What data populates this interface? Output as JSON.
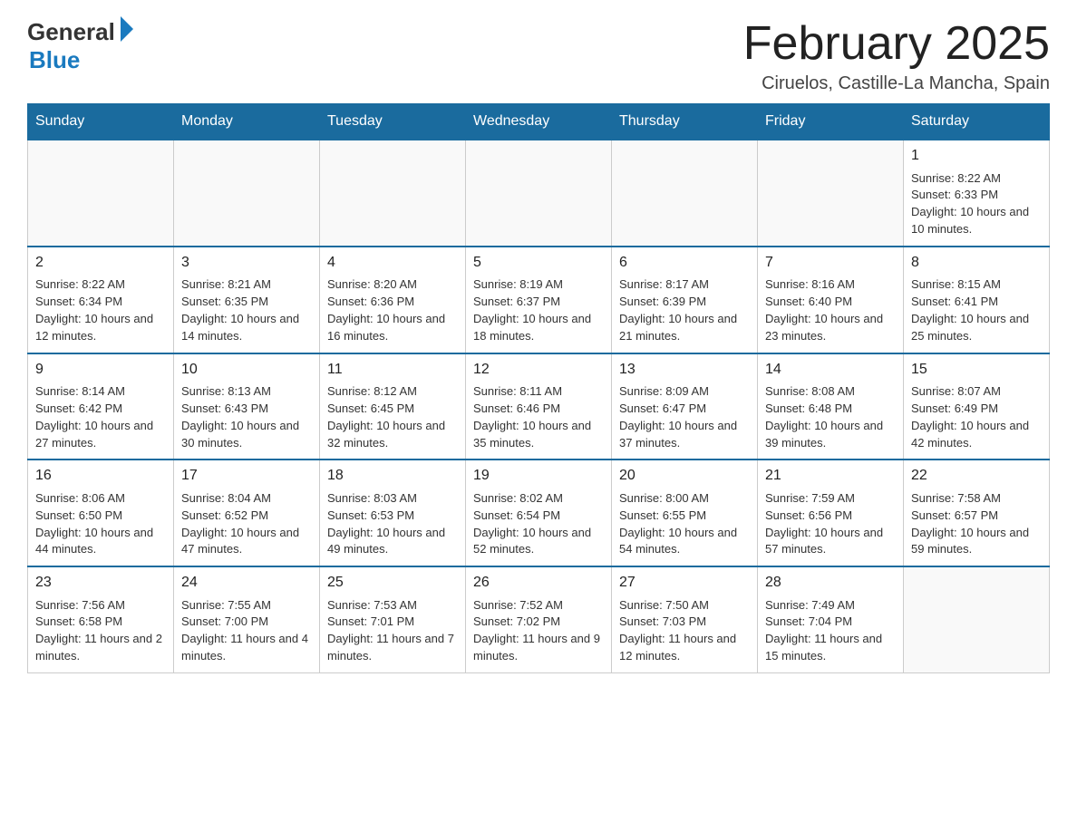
{
  "header": {
    "logo_general": "General",
    "logo_blue": "Blue",
    "month_title": "February 2025",
    "location": "Ciruelos, Castille-La Mancha, Spain"
  },
  "weekdays": [
    "Sunday",
    "Monday",
    "Tuesday",
    "Wednesday",
    "Thursday",
    "Friday",
    "Saturday"
  ],
  "weeks": [
    [
      {
        "day": "",
        "info": ""
      },
      {
        "day": "",
        "info": ""
      },
      {
        "day": "",
        "info": ""
      },
      {
        "day": "",
        "info": ""
      },
      {
        "day": "",
        "info": ""
      },
      {
        "day": "",
        "info": ""
      },
      {
        "day": "1",
        "info": "Sunrise: 8:22 AM\nSunset: 6:33 PM\nDaylight: 10 hours and 10 minutes."
      }
    ],
    [
      {
        "day": "2",
        "info": "Sunrise: 8:22 AM\nSunset: 6:34 PM\nDaylight: 10 hours and 12 minutes."
      },
      {
        "day": "3",
        "info": "Sunrise: 8:21 AM\nSunset: 6:35 PM\nDaylight: 10 hours and 14 minutes."
      },
      {
        "day": "4",
        "info": "Sunrise: 8:20 AM\nSunset: 6:36 PM\nDaylight: 10 hours and 16 minutes."
      },
      {
        "day": "5",
        "info": "Sunrise: 8:19 AM\nSunset: 6:37 PM\nDaylight: 10 hours and 18 minutes."
      },
      {
        "day": "6",
        "info": "Sunrise: 8:17 AM\nSunset: 6:39 PM\nDaylight: 10 hours and 21 minutes."
      },
      {
        "day": "7",
        "info": "Sunrise: 8:16 AM\nSunset: 6:40 PM\nDaylight: 10 hours and 23 minutes."
      },
      {
        "day": "8",
        "info": "Sunrise: 8:15 AM\nSunset: 6:41 PM\nDaylight: 10 hours and 25 minutes."
      }
    ],
    [
      {
        "day": "9",
        "info": "Sunrise: 8:14 AM\nSunset: 6:42 PM\nDaylight: 10 hours and 27 minutes."
      },
      {
        "day": "10",
        "info": "Sunrise: 8:13 AM\nSunset: 6:43 PM\nDaylight: 10 hours and 30 minutes."
      },
      {
        "day": "11",
        "info": "Sunrise: 8:12 AM\nSunset: 6:45 PM\nDaylight: 10 hours and 32 minutes."
      },
      {
        "day": "12",
        "info": "Sunrise: 8:11 AM\nSunset: 6:46 PM\nDaylight: 10 hours and 35 minutes."
      },
      {
        "day": "13",
        "info": "Sunrise: 8:09 AM\nSunset: 6:47 PM\nDaylight: 10 hours and 37 minutes."
      },
      {
        "day": "14",
        "info": "Sunrise: 8:08 AM\nSunset: 6:48 PM\nDaylight: 10 hours and 39 minutes."
      },
      {
        "day": "15",
        "info": "Sunrise: 8:07 AM\nSunset: 6:49 PM\nDaylight: 10 hours and 42 minutes."
      }
    ],
    [
      {
        "day": "16",
        "info": "Sunrise: 8:06 AM\nSunset: 6:50 PM\nDaylight: 10 hours and 44 minutes."
      },
      {
        "day": "17",
        "info": "Sunrise: 8:04 AM\nSunset: 6:52 PM\nDaylight: 10 hours and 47 minutes."
      },
      {
        "day": "18",
        "info": "Sunrise: 8:03 AM\nSunset: 6:53 PM\nDaylight: 10 hours and 49 minutes."
      },
      {
        "day": "19",
        "info": "Sunrise: 8:02 AM\nSunset: 6:54 PM\nDaylight: 10 hours and 52 minutes."
      },
      {
        "day": "20",
        "info": "Sunrise: 8:00 AM\nSunset: 6:55 PM\nDaylight: 10 hours and 54 minutes."
      },
      {
        "day": "21",
        "info": "Sunrise: 7:59 AM\nSunset: 6:56 PM\nDaylight: 10 hours and 57 minutes."
      },
      {
        "day": "22",
        "info": "Sunrise: 7:58 AM\nSunset: 6:57 PM\nDaylight: 10 hours and 59 minutes."
      }
    ],
    [
      {
        "day": "23",
        "info": "Sunrise: 7:56 AM\nSunset: 6:58 PM\nDaylight: 11 hours and 2 minutes."
      },
      {
        "day": "24",
        "info": "Sunrise: 7:55 AM\nSunset: 7:00 PM\nDaylight: 11 hours and 4 minutes."
      },
      {
        "day": "25",
        "info": "Sunrise: 7:53 AM\nSunset: 7:01 PM\nDaylight: 11 hours and 7 minutes."
      },
      {
        "day": "26",
        "info": "Sunrise: 7:52 AM\nSunset: 7:02 PM\nDaylight: 11 hours and 9 minutes."
      },
      {
        "day": "27",
        "info": "Sunrise: 7:50 AM\nSunset: 7:03 PM\nDaylight: 11 hours and 12 minutes."
      },
      {
        "day": "28",
        "info": "Sunrise: 7:49 AM\nSunset: 7:04 PM\nDaylight: 11 hours and 15 minutes."
      },
      {
        "day": "",
        "info": ""
      }
    ]
  ]
}
